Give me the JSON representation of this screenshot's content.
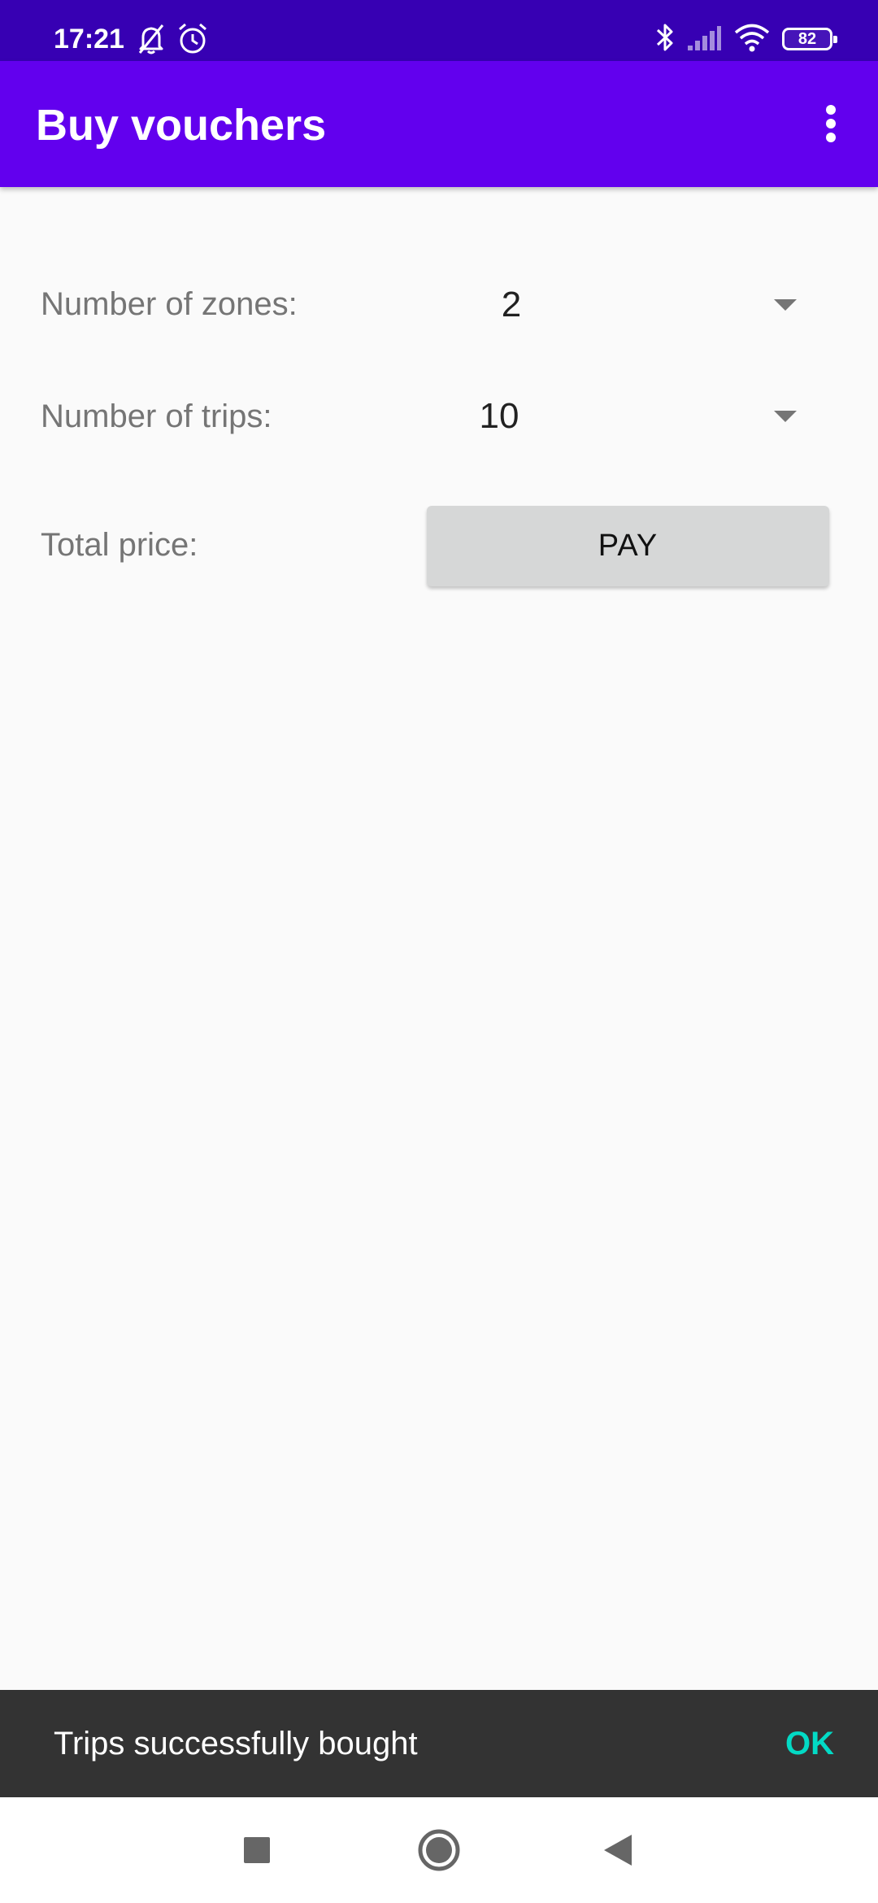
{
  "status_bar": {
    "time": "17:21",
    "left_icons": [
      "bell-off-icon",
      "alarm-icon"
    ],
    "right_icons": [
      "bluetooth-icon",
      "signal-icon",
      "wifi-icon"
    ],
    "battery": "82"
  },
  "app_bar": {
    "title": "Buy vouchers",
    "menu_icon": "more-vert-icon"
  },
  "form": {
    "zones": {
      "label": "Number of zones:",
      "value": "2"
    },
    "trips": {
      "label": "Number of trips:",
      "value": "10"
    },
    "total": {
      "label": "Total price:"
    },
    "pay_label": "PAY"
  },
  "snackbar": {
    "message": "Trips successfully bought",
    "action": "OK"
  },
  "nav_bar": {
    "buttons": [
      "recents-icon",
      "home-icon",
      "back-icon"
    ]
  },
  "colors": {
    "status_bar": "#3700b3",
    "primary": "#6200ee",
    "snackbar_action": "#03dac5"
  }
}
